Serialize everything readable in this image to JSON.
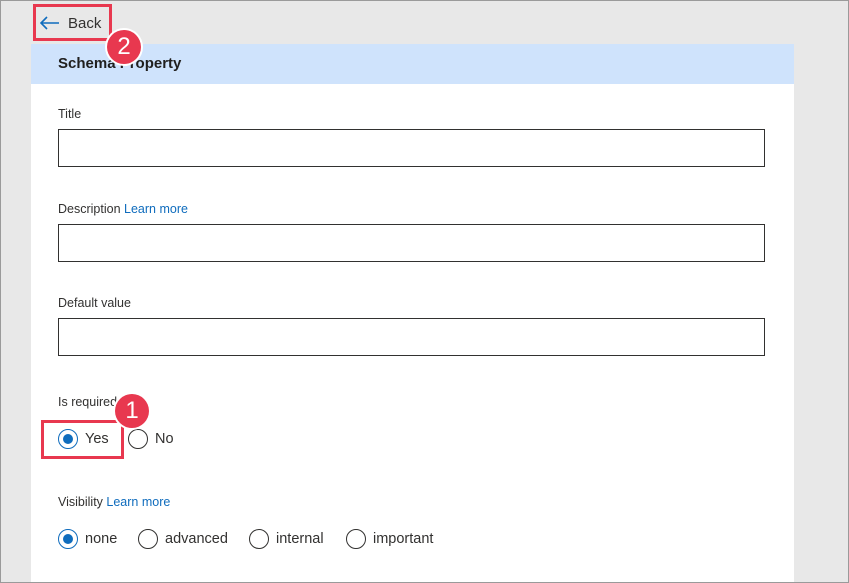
{
  "nav": {
    "back_label": "Back"
  },
  "panel": {
    "title": "Schema Property"
  },
  "fields": {
    "title": {
      "label": "Title",
      "value": ""
    },
    "description": {
      "label": "Description",
      "link": "Learn more",
      "value": ""
    },
    "default_value": {
      "label": "Default value",
      "value": ""
    }
  },
  "is_required": {
    "label": "Is required",
    "options": [
      {
        "label": "Yes",
        "checked": true
      },
      {
        "label": "No",
        "checked": false
      }
    ]
  },
  "visibility": {
    "label": "Visibility",
    "link": "Learn more",
    "options": [
      {
        "label": "none",
        "checked": true
      },
      {
        "label": "advanced",
        "checked": false
      },
      {
        "label": "internal",
        "checked": false
      },
      {
        "label": "important",
        "checked": false
      }
    ]
  },
  "annotations": {
    "step1": "1",
    "step2": "2"
  },
  "colors": {
    "accent": "#0f6cbd",
    "header_bg": "#cfe3fc",
    "highlight": "#e8384f"
  }
}
